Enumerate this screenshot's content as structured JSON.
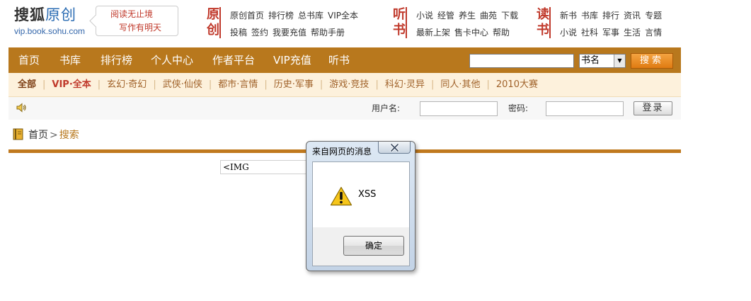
{
  "header": {
    "logo_part1": "搜狐",
    "logo_part2": "原创",
    "logo_url": "vip.book.sohu.com",
    "slogan_line1": "阅读无止境",
    "slogan_line2": "写作有明天",
    "groups": [
      {
        "label_top": "原",
        "label_bottom": "创",
        "row1": [
          "原创首页",
          "排行榜",
          "总书库",
          "VIP全本"
        ],
        "row2": [
          "投稿",
          "签约",
          "我要充值",
          "帮助手册"
        ]
      },
      {
        "label_top": "听",
        "label_bottom": "书",
        "row1": [
          "小说",
          "经管",
          "养生",
          "曲苑",
          "下载"
        ],
        "row2": [
          "最新上架",
          "售卡中心",
          "帮助"
        ]
      },
      {
        "label_top": "读",
        "label_bottom": "书",
        "row1": [
          "新书",
          "书库",
          "排行",
          "资讯",
          "专题"
        ],
        "row2": [
          "小说",
          "社科",
          "军事",
          "生活",
          "言情"
        ]
      }
    ]
  },
  "nav": {
    "items": [
      "首页",
      "书库",
      "排行榜",
      "个人中心",
      "作者平台",
      "VIP充值",
      "听书"
    ],
    "search_value": "",
    "search_type": "书名",
    "search_button": "搜索"
  },
  "categories": [
    "全部",
    "VIP·全本",
    "玄幻·奇幻",
    "武侠·仙侠",
    "都市·言情",
    "历史·军事",
    "游戏·竞技",
    "科幻·灵异",
    "同人·其他",
    "2010大赛"
  ],
  "login": {
    "username_label": "用户名:",
    "password_label": "密码:",
    "username_value": "",
    "password_value": "",
    "login_button": "登录"
  },
  "breadcrumb": {
    "home": "首页",
    "separator": ">",
    "current": "搜索"
  },
  "content": {
    "img_text": "<IMG"
  },
  "dialog": {
    "title": "来自网页的消息",
    "message": "XSS",
    "ok_button": "确定"
  },
  "colors": {
    "nav_bg": "#b8781d",
    "accent_red": "#c0392b",
    "category_bg": "#fdf1dc"
  }
}
